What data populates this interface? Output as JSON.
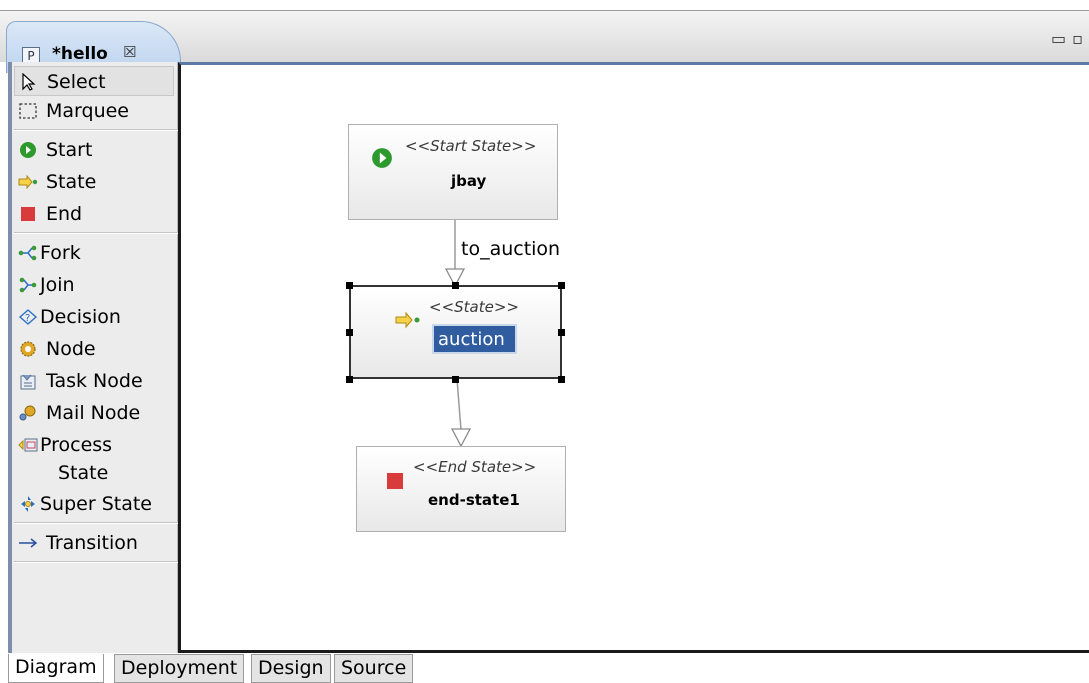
{
  "editor_tab": {
    "icon": "P",
    "title": "*hello",
    "close": "☒"
  },
  "window_controls": "▭▫",
  "palette": {
    "items": [
      {
        "label": "Select",
        "icon": "arrow-cursor-icon"
      },
      {
        "label": "Marquee",
        "icon": "marquee-icon"
      },
      {
        "label": "Start",
        "icon": "start-icon"
      },
      {
        "label": "State",
        "icon": "state-icon"
      },
      {
        "label": "End",
        "icon": "end-icon"
      },
      {
        "label": "Fork",
        "icon": "fork-icon"
      },
      {
        "label": "Join",
        "icon": "join-icon"
      },
      {
        "label": "Decision",
        "icon": "decision-icon"
      },
      {
        "label": "Node",
        "icon": "node-icon"
      },
      {
        "label": "Task Node",
        "icon": "task-node-icon"
      },
      {
        "label": "Mail Node",
        "icon": "mail-node-icon"
      },
      {
        "label": "Process",
        "label2": "State",
        "icon": "process-state-icon"
      },
      {
        "label": "Super State",
        "icon": "super-state-icon"
      },
      {
        "label": "Transition",
        "icon": "transition-arrow-icon"
      }
    ]
  },
  "diagram": {
    "start_node": {
      "stereotype": "<<Start State>>",
      "name": "jbay"
    },
    "state_node": {
      "stereotype": "<<State>>",
      "name": "auction"
    },
    "end_node": {
      "stereotype": "<<End State>>",
      "name": "end-state1"
    },
    "transition_label": "to_auction"
  },
  "bottom_tabs": [
    "Diagram",
    "Deployment",
    "Design",
    "Source"
  ],
  "colors": {
    "start_green": "#2e9a2e",
    "end_red": "#d93a3a",
    "state_yellow": "#e8c238",
    "selection_blue": "#2f5da0"
  }
}
